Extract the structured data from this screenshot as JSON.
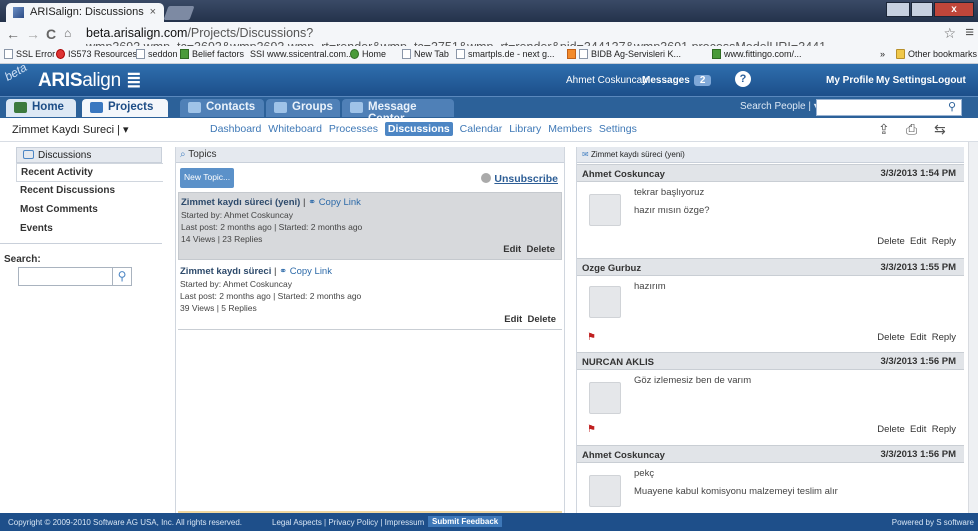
{
  "browser": {
    "tab_title": "ARISalign: Discussions",
    "tab_close": "×",
    "url_prefix": "beta.arisalign.com",
    "url_rest": "/Projects/Discussions?wmp3693.wmp_tc=3693&wmp3693.wmp_rt=render&wmp_tc=3751&wmp_rt=render&pid=344137&wmp3691.processModelURI=3441",
    "back_icon": "←",
    "forward_icon": "→",
    "reload_icon": "C",
    "home_icon": "🏠",
    "bookmarks": [
      "SSL Error",
      "IS573 Resources",
      "seddon",
      "Belief factors",
      "SSI www.ssicentral.com...",
      "Home",
      "New Tab",
      "smartpls.de - next g...",
      "BIDB Ag-Servisleri K...",
      "www.fittingo.com/...",
      "»",
      "Other bookmarks"
    ]
  },
  "app": {
    "beta": "beta",
    "logo_bold": "ARIS",
    "logo_light": "align",
    "user": "Ahmet Coskuncay",
    "messages_label": "Messages",
    "messages_count": "2",
    "help": "?",
    "my_profile": "My Profile",
    "my_settings": "My Settings",
    "logout": "Logout"
  },
  "nav": {
    "home": "Home",
    "projects": "Projects",
    "contacts": "Contacts",
    "groups": "Groups",
    "message_center": "Message Center",
    "search_people": "Search People | ▾"
  },
  "subnav": {
    "project": "Zimmet Kaydı Sureci | ▾",
    "links": [
      "Dashboard",
      "Whiteboard",
      "Processes",
      "Discussions",
      "Calendar",
      "Library",
      "Members",
      "Settings"
    ],
    "active": "Discussions"
  },
  "left": {
    "header": "Discussions",
    "items": [
      "Recent Activity",
      "Recent Discussions",
      "Most Comments",
      "Events"
    ],
    "search_label": "Search:"
  },
  "topics": {
    "header": "Topics",
    "new_topic": "New Topic...",
    "unsubscribe": "Unsubscribe",
    "list": [
      {
        "title": "Zimmet kaydı süreci (yeni)",
        "copy": "Copy Link",
        "started_by": "Started by:  Ahmet Coskuncay",
        "posted": "Last post: 2 months ago  |  Started:  2 months ago",
        "stats": "14 Views  |  23 Replies",
        "edit": "Edit",
        "delete": "Delete"
      },
      {
        "title": "Zimmet kaydı süreci",
        "copy": "Copy Link",
        "started_by": "Started by:  Ahmet Coskuncay",
        "posted": "Last post: 2 months ago  |  Started:  2 months ago",
        "stats": "39 Views  |  5 Replies",
        "edit": "Edit",
        "delete": "Delete"
      }
    ]
  },
  "posts": {
    "header": "Zimmet kaydı süreci (yeni)",
    "list": [
      {
        "author": "Ahmet Coskuncay",
        "date": "3/3/2013 1:54 PM",
        "lines": [
          "tekrar başlıyoruz",
          "hazır mısın özge?"
        ]
      },
      {
        "author": "Ozge Gurbuz",
        "date": "3/3/2013 1:55 PM",
        "lines": [
          "hazırım"
        ]
      },
      {
        "author": "NURCAN AKLIS",
        "date": "3/3/2013 1:56 PM",
        "lines": [
          "Göz izlemesiz ben de varım"
        ]
      },
      {
        "author": "Ahmet Coskuncay",
        "date": "3/3/2013 1:56 PM",
        "lines": [
          "pekç",
          "Muayene kabul komisyonu malzemeyi teslim alır"
        ]
      }
    ],
    "actions": {
      "delete": "Delete",
      "edit": "Edit",
      "reply": "Reply"
    }
  },
  "footer": {
    "copyright": "Copyright © 2009-2010 Software AG USA, Inc. All rights reserved.",
    "legal": "Legal Aspects | Privacy Policy | Impressum",
    "feedback": "Submit Feedback",
    "powered": "Powered by  S software"
  }
}
